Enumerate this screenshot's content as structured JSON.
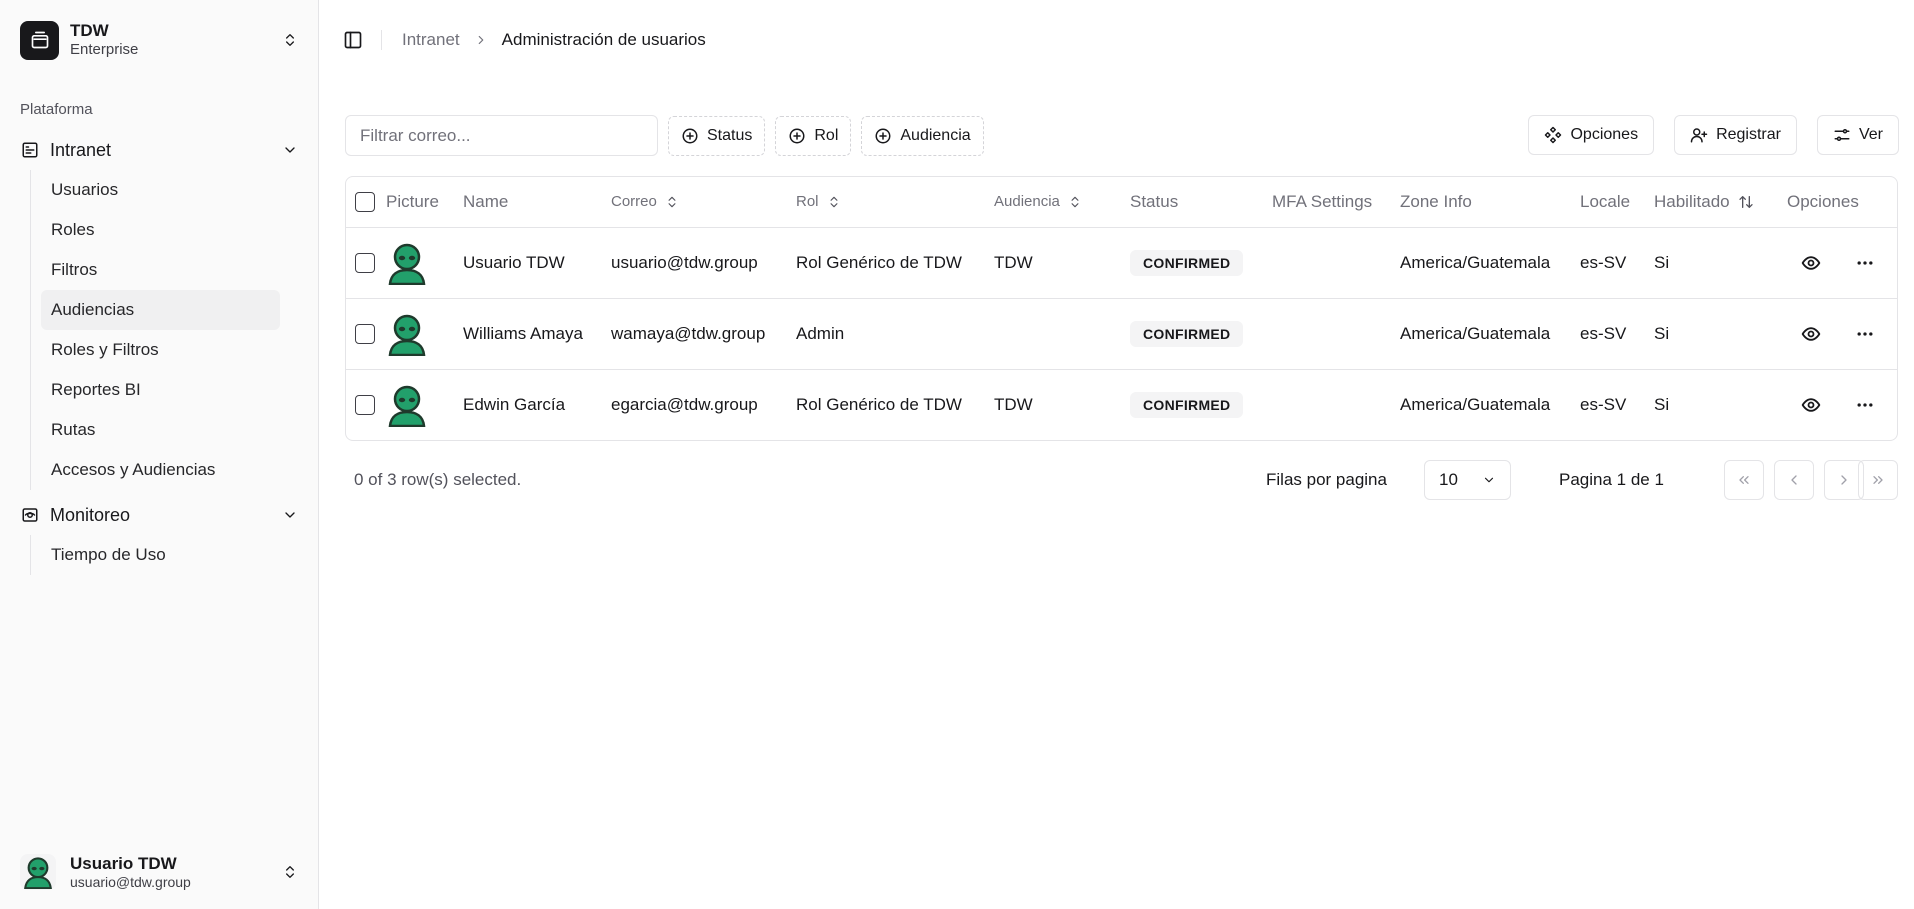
{
  "org": {
    "name": "TDW",
    "plan": "Enterprise"
  },
  "sidebar": {
    "section_label": "Plataforma",
    "groups": [
      {
        "label": "Intranet",
        "icon": "app-window-icon",
        "items": [
          "Usuarios",
          "Roles",
          "Filtros",
          "Audiencias",
          "Roles y Filtros",
          "Reportes BI",
          "Rutas",
          "Accesos y Audiencias"
        ],
        "active": "Audiencias"
      },
      {
        "label": "Monitoreo",
        "icon": "monitor-eye-icon",
        "items": [
          "Tiempo de Uso"
        ]
      }
    ]
  },
  "current_user": {
    "name": "Usuario TDW",
    "email": "usuario@tdw.group"
  },
  "breadcrumb": {
    "parent": "Intranet",
    "current": "Administración de usuarios"
  },
  "filters": {
    "search_placeholder": "Filtrar correo...",
    "facets": [
      "Status",
      "Rol",
      "Audiencia"
    ]
  },
  "actions": {
    "options": "Opciones",
    "register": "Registrar",
    "view": "Ver"
  },
  "table": {
    "headers": {
      "picture": "Picture",
      "name": "Name",
      "email": "Correo",
      "role": "Rol",
      "audience": "Audiencia",
      "status": "Status",
      "mfa": "MFA Settings",
      "zone": "Zone Info",
      "locale": "Locale",
      "enabled": "Habilitado",
      "options": "Opciones"
    },
    "rows": [
      {
        "name": "Usuario TDW",
        "email": "usuario@tdw.group",
        "role": "Rol Genérico de TDW",
        "audience": "TDW",
        "status": "CONFIRMED",
        "mfa": "",
        "zone": "America/Guatemala",
        "locale": "es-SV",
        "enabled": "Si"
      },
      {
        "name": "Williams Amaya",
        "email": "wamaya@tdw.group",
        "role": "Admin",
        "audience": "",
        "status": "CONFIRMED",
        "mfa": "",
        "zone": "America/Guatemala",
        "locale": "es-SV",
        "enabled": "Si"
      },
      {
        "name": "Edwin García",
        "email": "egarcia@tdw.group",
        "role": "Rol Genérico de TDW",
        "audience": "TDW",
        "status": "CONFIRMED",
        "mfa": "",
        "zone": "America/Guatemala",
        "locale": "es-SV",
        "enabled": "Si"
      }
    ]
  },
  "pagination": {
    "selected_text": "0 of 3 row(s) selected.",
    "rows_per_page_label": "Filas por pagina",
    "rows_per_page": "10",
    "page_text": "Pagina 1 de 1"
  },
  "colors": {
    "avatar_green": "#22a06b",
    "avatar_dark": "#1f3a2c",
    "text": "#18181b",
    "muted": "#71717a",
    "border": "#e4e4e7"
  }
}
